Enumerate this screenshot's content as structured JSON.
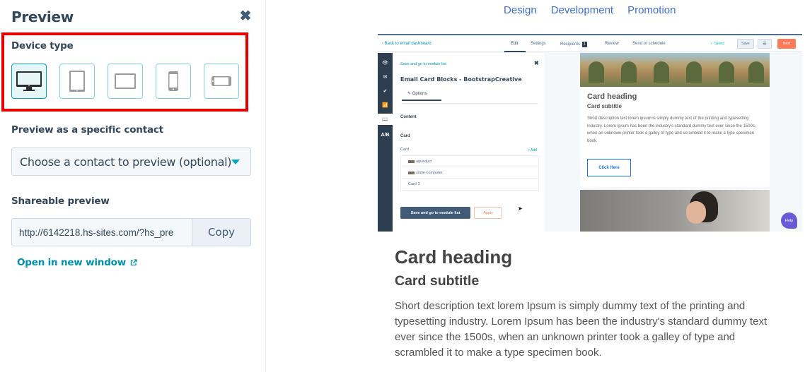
{
  "left_panel": {
    "title": "Preview",
    "close_icon": "close-icon",
    "device_type": {
      "label": "Device type",
      "selected": "desktop",
      "devices": [
        {
          "id": "desktop",
          "icon": "desktop-monitor-icon"
        },
        {
          "id": "tablet-portrait",
          "icon": "tablet-portrait-icon"
        },
        {
          "id": "tablet-landscape",
          "icon": "tablet-landscape-icon"
        },
        {
          "id": "mobile-portrait",
          "icon": "mobile-portrait-icon"
        },
        {
          "id": "mobile-landscape",
          "icon": "mobile-landscape-icon"
        }
      ]
    },
    "contact": {
      "label": "Preview as a specific contact",
      "selected_value": "Choose a contact to preview (optional)"
    },
    "shareable": {
      "label": "Shareable preview",
      "url": "http://6142218.hs-sites.com/?hs_pre",
      "copy_label": "Copy",
      "open_label": "Open in new window"
    }
  },
  "top_nav": {
    "links": [
      "Design",
      "Development",
      "Promotion"
    ],
    "color": "#3d6fcf"
  },
  "embedded_screenshot": {
    "header": {
      "back_link": "‹ Back to email dashboard",
      "tabs": [
        "Edit",
        "Settings",
        "Recipients",
        "Review",
        "Send or schedule"
      ],
      "recipients_count": "1",
      "saved_label": "✓ Saved",
      "save_label": "Save",
      "menu_icon": "☰",
      "next_label": "Next"
    },
    "rail": [
      "👁",
      "✉",
      "✔",
      "📶",
      "📖",
      "A/B"
    ],
    "editor": {
      "back_link": "Save and go to module list",
      "title": "Email Card Blocks - BootstrapCreative",
      "tab": "✎ Options",
      "content_heading": "Content",
      "card_heading": "Card",
      "card_label": "Card",
      "add_label": "+ Add",
      "items": [
        "aqueduct",
        "smile-computer",
        "Card 3"
      ],
      "save_button": "Save and go to module list",
      "apply_button": "Apply"
    },
    "canvas": {
      "card_heading": "Card heading",
      "card_subtitle": "Card subtitle",
      "card_text": "Short description text lorem ipsum is simply dummy text of the printing and typesetting industry. Lorem Ipsum has been the industry's standard dummy text ever since the 1500s, when an unknown printer took a galley of type and scrambled it to make a type specimen book.",
      "button_label": "Click Here",
      "help_label": "Help"
    }
  },
  "card_content": {
    "heading": "Card heading",
    "subtitle": "Card subtitle",
    "body": "Short description text lorem Ipsum is simply dummy text of the printing and typesetting industry. Lorem Ipsum has been the industry's standard dummy text ever since the 1500s, when an unknown printer took a galley of type and scrambled it to make a type specimen book."
  }
}
